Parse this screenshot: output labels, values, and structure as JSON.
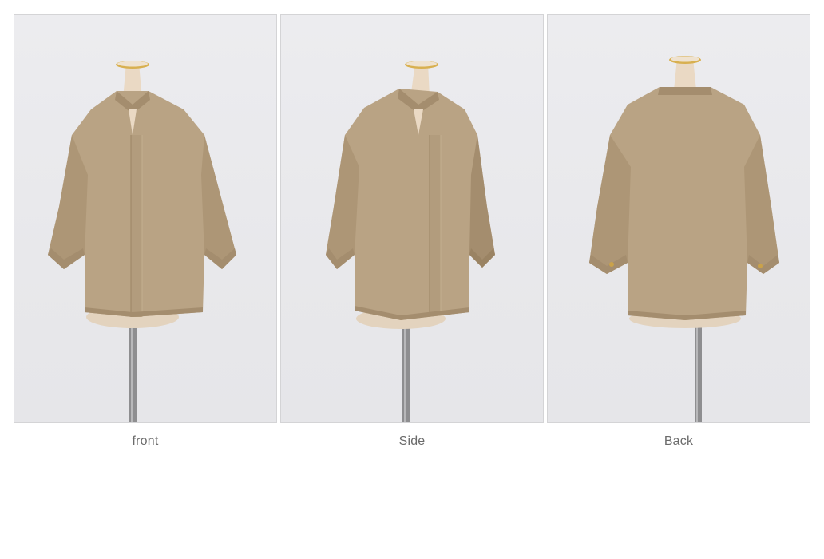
{
  "views": [
    {
      "caption": "front",
      "view": "front"
    },
    {
      "caption": "Side",
      "view": "side"
    },
    {
      "caption": "Back",
      "view": "back"
    }
  ],
  "colors": {
    "blouse": "#b9a384",
    "blouse_shadow": "#a48d6e",
    "blouse_highlight": "#c6b294",
    "mannequin": "#e7d7c3",
    "stand": "#8c8c8c",
    "background": "#ebebee"
  }
}
